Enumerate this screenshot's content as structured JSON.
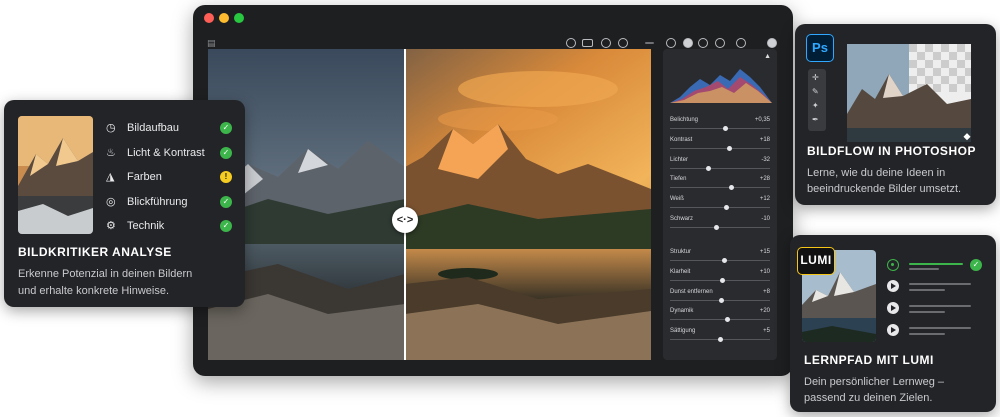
{
  "window": {
    "toolbar_icons": [
      "eye-icon",
      "compare-icon",
      "circle-icon",
      "copy-icon",
      "minus-icon",
      "circle-icon",
      "half-circle-icon",
      "rotate-icon",
      "sun-icon",
      "circle-icon",
      "crop-icon"
    ]
  },
  "divider": {
    "handle_label": "<·>"
  },
  "adjustments": {
    "group1": [
      {
        "label": "Belichtung",
        "value": "+0,35",
        "level": 0.56
      },
      {
        "label": "Kontrast",
        "value": "+18",
        "level": 0.6
      },
      {
        "label": "Lichter",
        "value": "-32",
        "level": 0.38
      },
      {
        "label": "Tiefen",
        "value": "+28",
        "level": 0.62
      },
      {
        "label": "Weiß",
        "value": "+12",
        "level": 0.57
      },
      {
        "label": "Schwarz",
        "value": "-10",
        "level": 0.46
      }
    ],
    "group2": [
      {
        "label": "Struktur",
        "value": "+15",
        "level": 0.55
      },
      {
        "label": "Klarheit",
        "value": "+10",
        "level": 0.53
      },
      {
        "label": "Dunst entfernen",
        "value": "+8",
        "level": 0.52
      },
      {
        "label": "Dynamik",
        "value": "+20",
        "level": 0.58
      },
      {
        "label": "Sättigung",
        "value": "+5",
        "level": 0.51
      }
    ]
  },
  "analyse": {
    "title": "BILDKRITIKER ANALYSE",
    "desc_line1": "Erkenne Potenzial in deinen Bildern",
    "desc_line2": "und erhalte konkrete Hinweise.",
    "items": [
      {
        "label": "Bildaufbau",
        "icon": "clock-icon",
        "status": "ok"
      },
      {
        "label": "Licht & Kontrast",
        "icon": "light-icon",
        "status": "ok"
      },
      {
        "label": "Farben",
        "icon": "palette-icon",
        "status": "warn"
      },
      {
        "label": "Blickführung",
        "icon": "eye-target-icon",
        "status": "ok"
      },
      {
        "label": "Technik",
        "icon": "gear-icon",
        "status": "ok"
      }
    ],
    "status_ok_glyph": "✓",
    "status_warn_glyph": "!"
  },
  "photoshop": {
    "logo": "Ps",
    "title": "BILDFLOW IN PHOTOSHOP",
    "desc_line1": "Lerne, wie du deine Ideen in",
    "desc_line2": "beeindruckende Bilder umsetzt."
  },
  "lumi": {
    "logo": "LUMI",
    "title": "LERNPFAD MIT LUMI",
    "desc_line1": "Dein persönlicher Lernweg –",
    "desc_line2": "passend zu deinen Zielen.",
    "check_glyph": "✓"
  },
  "colors": {
    "accent_green": "#3cb54a",
    "warn_yellow": "#f5cc21",
    "ps_blue": "#31a8ff",
    "lumi_gold": "#f5c518"
  }
}
